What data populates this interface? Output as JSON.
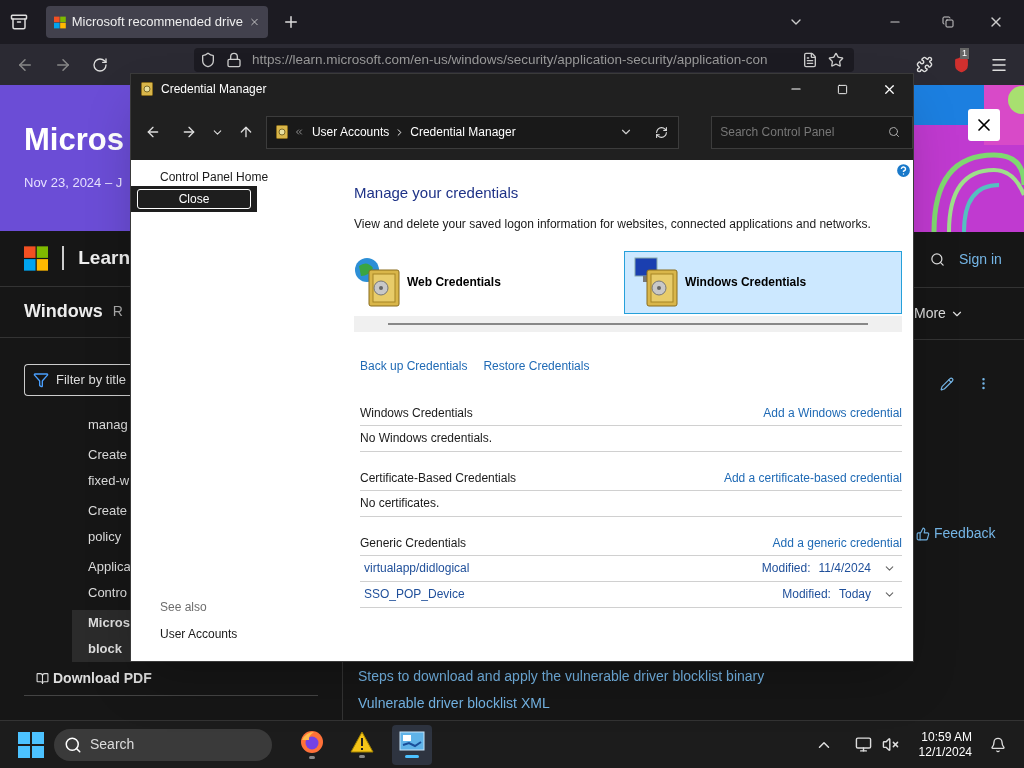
{
  "browser": {
    "tab_title": "Microsoft recommended drive",
    "url": "https://learn.microsoft.com/en-us/windows/security/application-security/application-con",
    "extension_badge": "1"
  },
  "page": {
    "hero_title": "Micros",
    "hero_date": "Nov 23, 2024 – J",
    "site_name": "Learn",
    "product": "Windows",
    "nav_fragment": "R",
    "filter_placeholder": "Filter by title",
    "toc": [
      {
        "lines": [
          "manag"
        ],
        "selected": false
      },
      {
        "lines": [
          "Create",
          "fixed-w"
        ],
        "selected": false
      },
      {
        "lines": [
          "Create",
          "policy"
        ],
        "selected": false
      },
      {
        "lines": [
          "Applica",
          "Contro"
        ],
        "selected": false
      },
      {
        "lines": [
          "Micros",
          "block"
        ],
        "selected": true
      }
    ],
    "download": "Download PDF",
    "sign_in": "Sign in",
    "more": "More",
    "feedback": "Feedback",
    "links": [
      "Steps to download and apply the vulnerable driver blocklist binary",
      "Vulnerable driver blocklist XML"
    ]
  },
  "credential_window": {
    "title": "Credential Manager",
    "breadcrumb": [
      "User Accounts",
      "Credential Manager"
    ],
    "search_placeholder": "Search Control Panel",
    "side_links": [
      "Control Panel Home"
    ],
    "tooltip": "Close",
    "see_also_heading": "See also",
    "see_also": [
      "User Accounts"
    ],
    "heading": "Manage your credentials",
    "description": "View and delete your saved logon information for websites, connected applications and networks.",
    "types": [
      {
        "kind": "web",
        "label": "Web Credentials",
        "selected": false
      },
      {
        "kind": "windows",
        "label": "Windows Credentials",
        "selected": true
      }
    ],
    "actions": [
      "Back up Credentials",
      "Restore Credentials"
    ],
    "sections": [
      {
        "title": "Windows Credentials",
        "add_link": "Add a Windows credential",
        "empty_text": "No Windows credentials."
      },
      {
        "title": "Certificate-Based Credentials",
        "add_link": "Add a certificate-based credential",
        "empty_text": "No certificates."
      },
      {
        "title": "Generic Credentials",
        "add_link": "Add a generic credential",
        "items": [
          {
            "name": "virtualapp/didlogical",
            "modified_label": "Modified:",
            "modified": "11/4/2024",
            "expanded": false
          },
          {
            "name": "SSO_POP_Device",
            "modified_label": "Modified:",
            "modified": "Today",
            "expanded": false
          }
        ]
      }
    ]
  },
  "taskbar": {
    "search_placeholder": "Search",
    "apps": [
      {
        "kind": "firefox",
        "selected": false
      },
      {
        "kind": "warning",
        "selected": false
      },
      {
        "kind": "control-panel",
        "selected": true
      }
    ],
    "time": "10:59 AM",
    "date": "12/1/2024"
  }
}
